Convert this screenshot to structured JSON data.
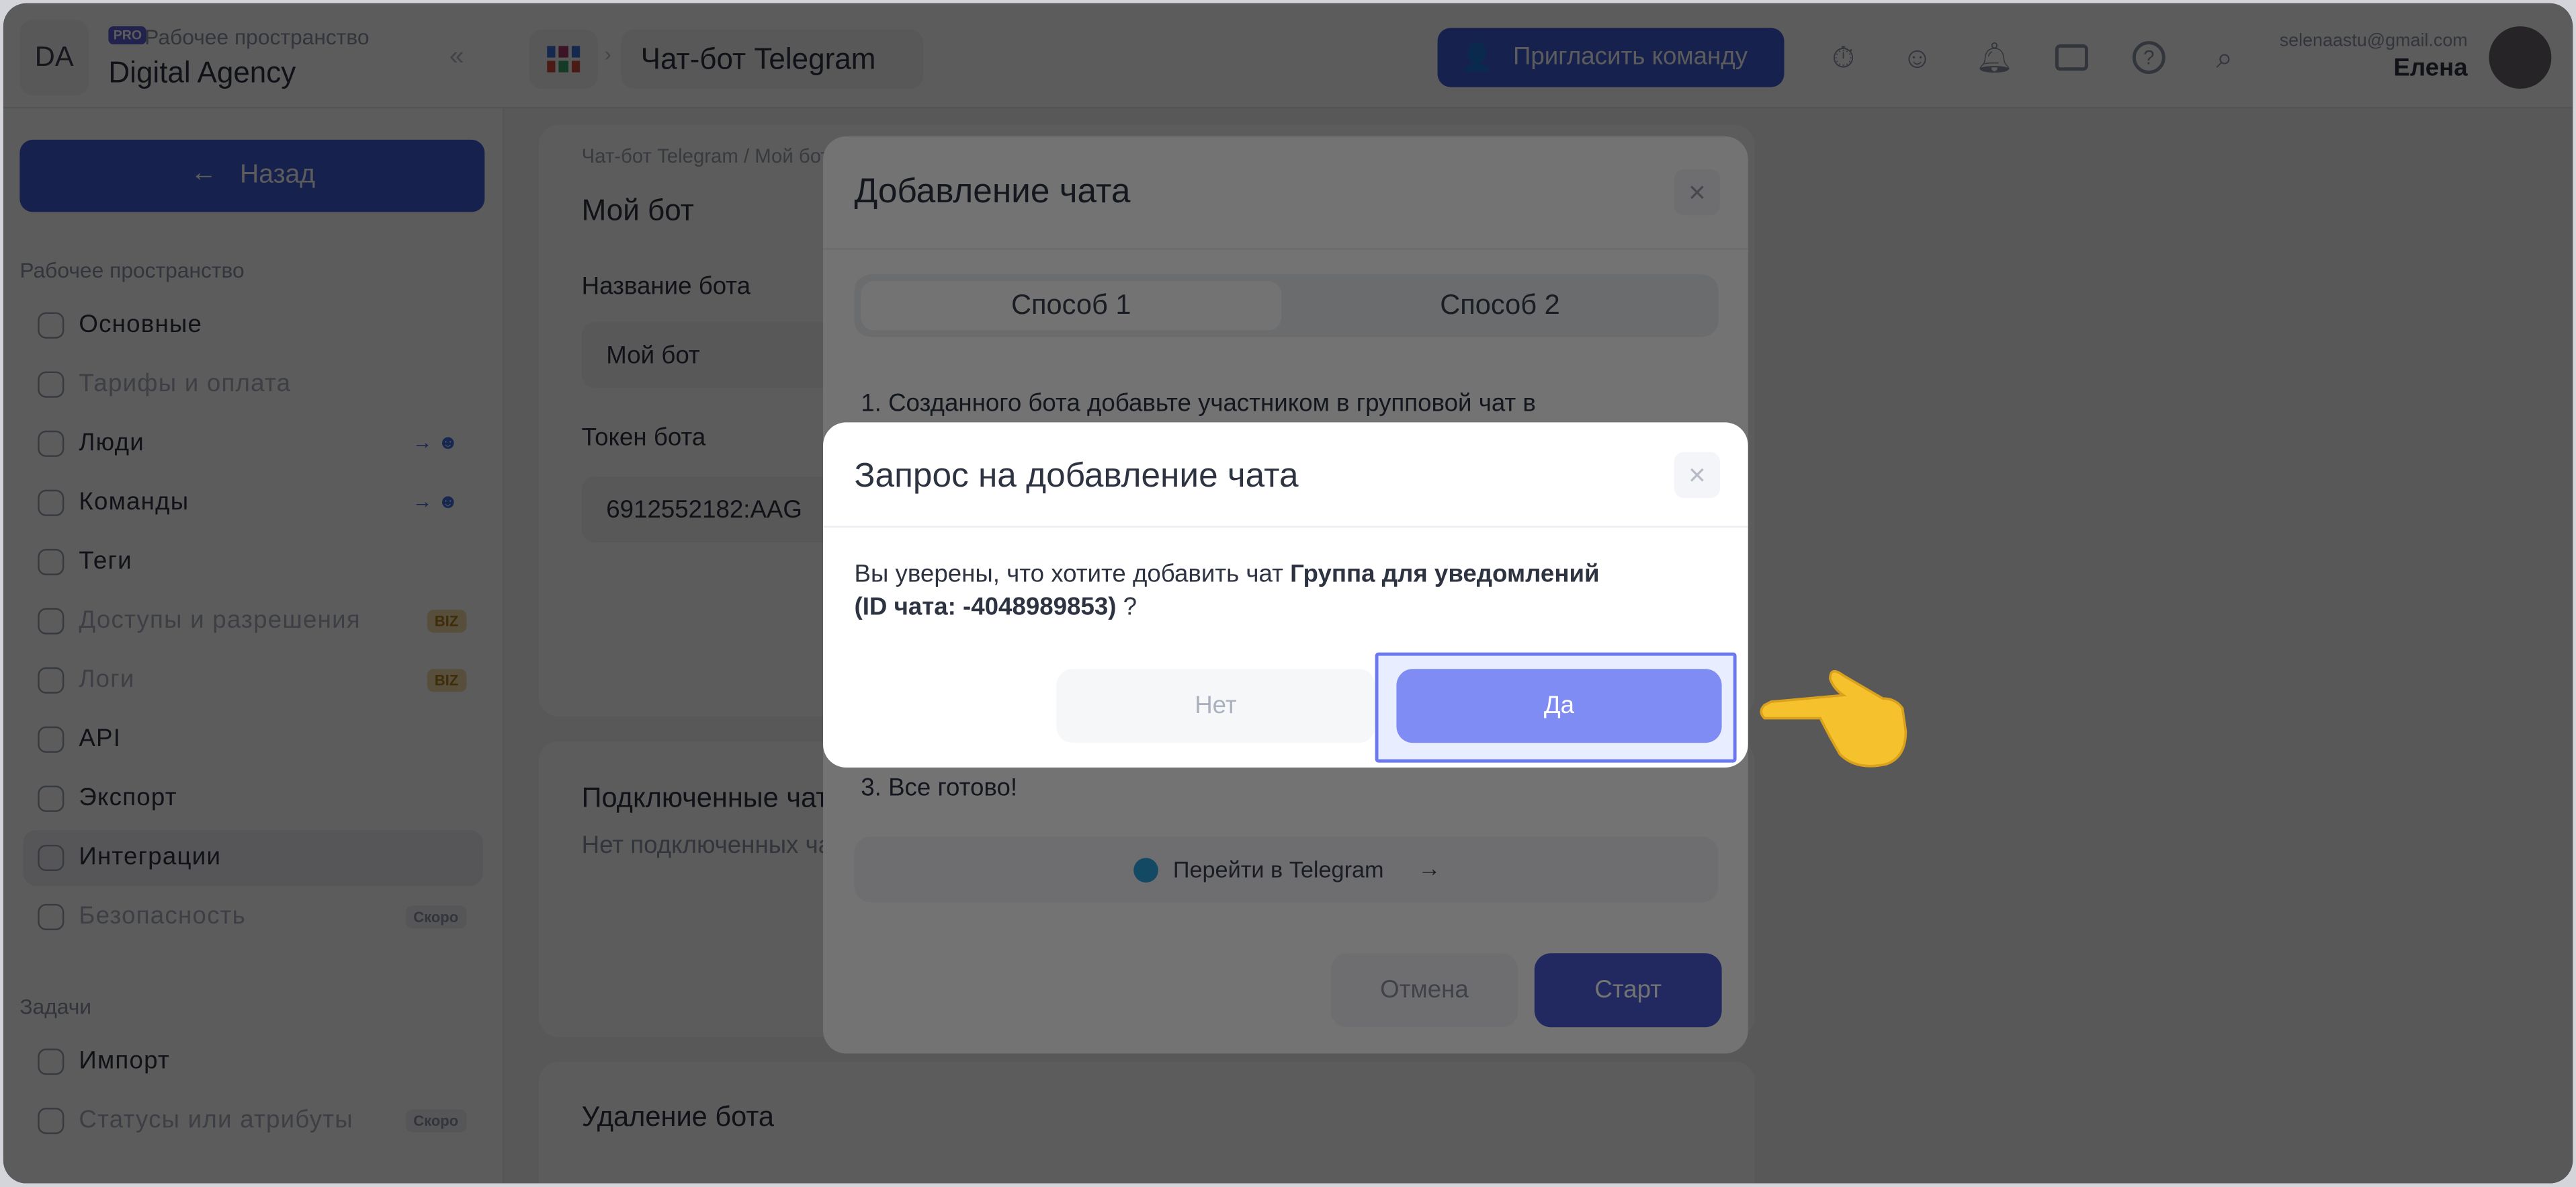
{
  "topbar": {
    "workspace_initials": "DA",
    "plan_badge": "PRO",
    "workspace_label": "Рабочее пространство",
    "workspace_name": "Digital Agency",
    "breadcrumb_title": "Чат-бот Telegram",
    "invite_button": "Пригласить команду",
    "user_email": "selenaastu@gmail.com",
    "user_name": "Елена",
    "icons": [
      "timer-icon",
      "team-icon",
      "bell-icon",
      "folder-icon",
      "help-icon",
      "search-icon"
    ]
  },
  "sidebar": {
    "back_button": "Назад",
    "section_workspace": "Рабочее пространство",
    "items": [
      {
        "label": "Основные",
        "state": "normal"
      },
      {
        "label": "Тарифы и оплата",
        "state": "dim"
      },
      {
        "label": "Люди",
        "state": "normal",
        "extra": "team"
      },
      {
        "label": "Команды",
        "state": "normal",
        "extra": "team"
      },
      {
        "label": "Теги",
        "state": "normal"
      },
      {
        "label": "Доступы и разрешения",
        "state": "dim",
        "badge": "BIZ"
      },
      {
        "label": "Логи",
        "state": "dim",
        "badge": "BIZ"
      },
      {
        "label": "API",
        "state": "normal"
      },
      {
        "label": "Экспорт",
        "state": "normal"
      },
      {
        "label": "Интеграции",
        "state": "active"
      },
      {
        "label": "Безопасность",
        "state": "dim",
        "badge": "Скоро"
      }
    ],
    "section_tasks": "Задачи",
    "task_items": [
      {
        "label": "Импорт",
        "state": "normal"
      },
      {
        "label": "Статусы или атрибуты",
        "state": "dim",
        "badge": "Скоро"
      }
    ]
  },
  "main": {
    "breadcrumb": "Чат-бот Telegram / Мой бот",
    "title": "Мой бот",
    "name_label": "Название бота",
    "name_value": "Мой бот",
    "token_label": "Токен бота",
    "token_value": "6912552182:AAG",
    "connected_title": "Подключенные чаты",
    "connected_empty": "Нет подключенных чатов",
    "delete_title": "Удаление бота"
  },
  "add_chat_modal": {
    "title": "Добавление чата",
    "tabs": [
      "Способ 1",
      "Способ 2"
    ],
    "active_tab": 0,
    "step1": "1. Созданного бота добавьте участником в групповой чат в",
    "step3": "3. Все готово!",
    "telegram_link": "Перейти в Telegram",
    "cancel": "Отмена",
    "start": "Старт"
  },
  "confirm_modal": {
    "title": "Запрос на добавление чата",
    "text_prefix": "Вы уверены, что хотите добавить чат ",
    "chat_name": "Группа для уведомлений",
    "chat_id": "(ID чата: -4048989853)",
    "text_suffix": " ?",
    "no": "Нет",
    "yes": "Да"
  },
  "colors": {
    "accent": "#7f8cf3",
    "highlight_border": "#6b78f0",
    "highlight_bg": "#e8eeff",
    "primary_dark": "#4a5bd6"
  }
}
